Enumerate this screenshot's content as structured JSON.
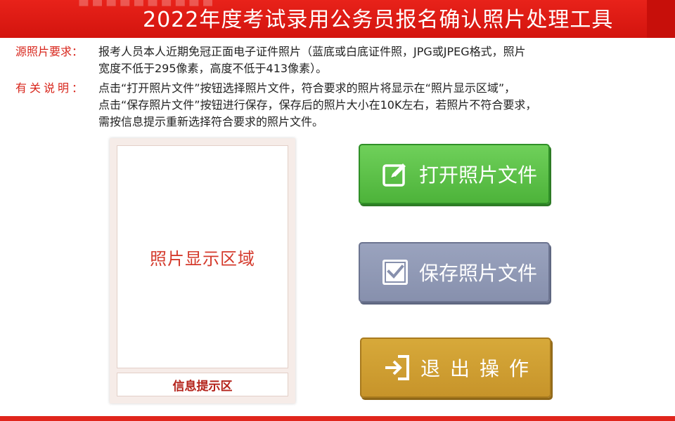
{
  "header": {
    "title": "2022年度考试录用公务员报名确认照片处理工具"
  },
  "info": {
    "source_label": "源照片要求：",
    "source_lines": [
      "报考人员本人近期免冠正面电子证件照片（蓝底或白底证件照，JPG或JPEG格式，照片",
      "宽度不低于295像素，高度不低于413像素）。"
    ],
    "notes_label": "有关说明：",
    "notes_lines": [
      "点击“打开照片文件”按钮选择照片文件，符合要求的照片将显示在“照片显示区域”，",
      "点击“保存照片文件”按钮进行保存，保存后的照片大小在10K左右，若照片不符合要求，",
      "需按信息提示重新选择符合要求的照片文件。"
    ]
  },
  "photo": {
    "area_label": "照片显示区域",
    "message_label": "信息提示区"
  },
  "buttons": {
    "open_label": "打开照片文件",
    "save_label": "保存照片文件",
    "exit_label": "退出操作"
  },
  "colors": {
    "brand_red": "#d3140e",
    "open_green": "#4db33a",
    "save_gray_blue": "#8790ad",
    "exit_gold": "#c7942a"
  },
  "icons": {
    "open": "edit-icon",
    "save": "checkbox-icon",
    "exit": "sign-in-arrow-icon"
  }
}
